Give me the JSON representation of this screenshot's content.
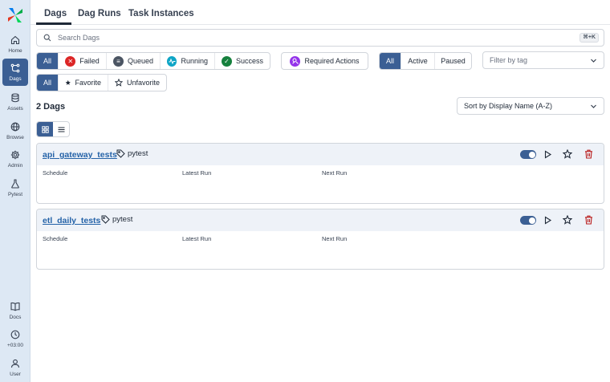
{
  "sidebar": {
    "items": [
      {
        "label": "Home",
        "icon": "home-icon"
      },
      {
        "label": "Dags",
        "icon": "dags-icon",
        "active": true
      },
      {
        "label": "Assets",
        "icon": "database-icon"
      },
      {
        "label": "Browse",
        "icon": "globe-icon"
      },
      {
        "label": "Admin",
        "icon": "gear-icon"
      },
      {
        "label": "Pytest",
        "icon": "flask-icon"
      }
    ],
    "bottom": [
      {
        "label": "Docs",
        "icon": "book-icon"
      },
      {
        "label": "+03:00",
        "icon": "clock-icon"
      },
      {
        "label": "User",
        "icon": "user-icon"
      }
    ]
  },
  "tabs": [
    "Dags",
    "Dag Runs",
    "Task Instances"
  ],
  "search": {
    "placeholder": "Search Dags",
    "shortcut": "⌘+K"
  },
  "state_filter": {
    "all": "All",
    "failed": "Failed",
    "queued": "Queued",
    "running": "Running",
    "success": "Success"
  },
  "required_actions": "Required Actions",
  "active_filter": {
    "all": "All",
    "active": "Active",
    "paused": "Paused"
  },
  "tag_filter": {
    "placeholder": "Filter by tag"
  },
  "favorite_filter": {
    "all": "All",
    "favorite": "Favorite",
    "unfavorite": "Unfavorite"
  },
  "count_label": "2 Dags",
  "sort": {
    "value": "Sort by Display Name (A-Z)"
  },
  "columns": {
    "schedule": "Schedule",
    "latest_run": "Latest Run",
    "next_run": "Next Run"
  },
  "dags": [
    {
      "name": "api_gateway_tests",
      "tag": "pytest"
    },
    {
      "name": "etl_daily_tests",
      "tag": "pytest"
    }
  ],
  "colors": {
    "accent": "#3b5f94",
    "failed": "#dc2626",
    "queued": "#4b5563",
    "running": "#0ea5c6",
    "success": "#15803d",
    "required": "#9333ea",
    "delete": "#b91c1c"
  }
}
